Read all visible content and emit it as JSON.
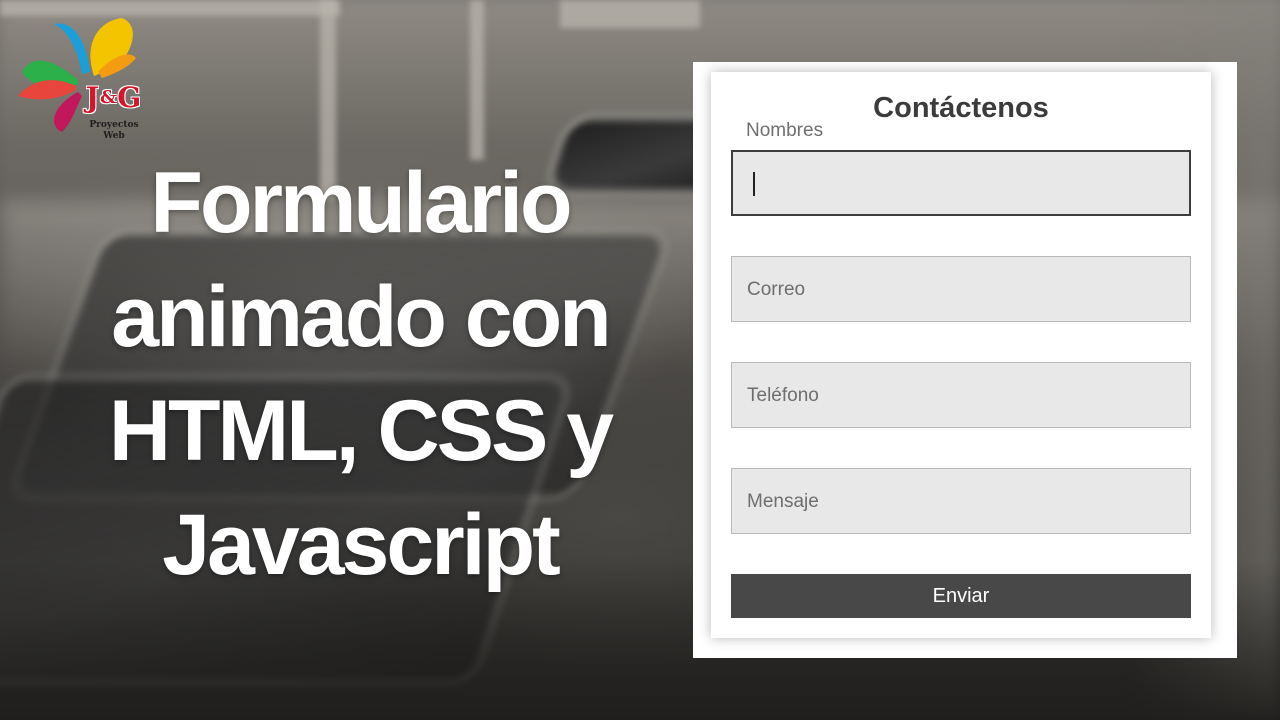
{
  "logo": {
    "letters_left": "J",
    "letters_amp": "&",
    "letters_right": "G",
    "subtitle_line1": "Proyectos",
    "subtitle_line2": "Web",
    "colors": [
      "#1a9fd8",
      "#f5c400",
      "#e8453c",
      "#2bb04a",
      "#c2185b",
      "#7b3fa0"
    ]
  },
  "headline": {
    "line1": "Formulario",
    "line2": "animado con",
    "line3": "HTML, CSS y",
    "line4": "Javascript"
  },
  "form": {
    "title": "Contáctenos",
    "fields": [
      {
        "label": "Nombres",
        "value": "",
        "focused": true
      },
      {
        "label": "Correo",
        "value": "",
        "focused": false
      },
      {
        "label": "Teléfono",
        "value": "",
        "focused": false
      },
      {
        "label": "Mensaje",
        "value": "",
        "focused": false
      }
    ],
    "submit_label": "Enviar"
  },
  "colors": {
    "field_bg": "#e8e8e8",
    "button_bg": "#484848",
    "title_text": "#3b3b3b"
  }
}
